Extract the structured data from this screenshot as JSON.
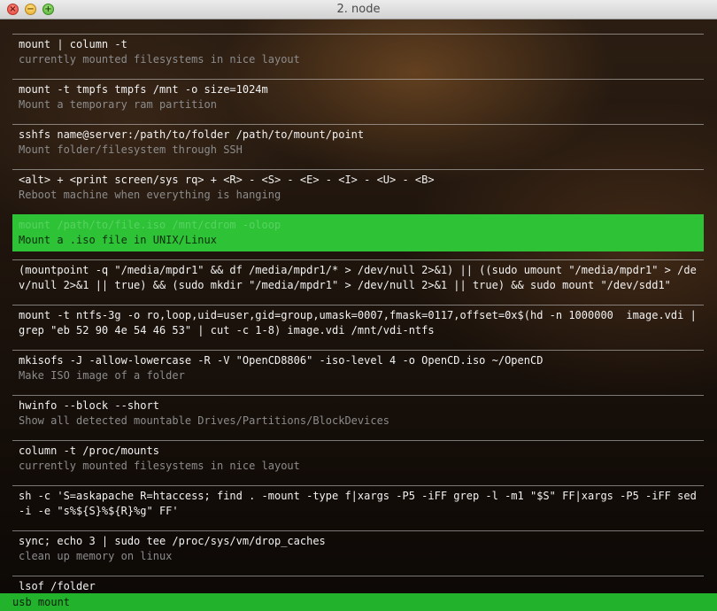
{
  "window": {
    "title": "2. node",
    "controls": {
      "close": "close-icon",
      "minimize": "minimize-icon",
      "zoom": "zoom-icon"
    }
  },
  "colors": {
    "selection": "#2ec236",
    "statusbar": "#22b22b",
    "command_text": "#f2f2f2",
    "description_text": "#8c8c8c"
  },
  "results": [
    {
      "command": "mount | column -t",
      "description": "currently mounted filesystems in nice layout"
    },
    {
      "command": "mount -t tmpfs tmpfs /mnt -o size=1024m",
      "description": "Mount a temporary ram partition"
    },
    {
      "command": "sshfs name@server:/path/to/folder /path/to/mount/point",
      "description": "Mount folder/filesystem through SSH"
    },
    {
      "command": "<alt> + <print screen/sys rq> + <R> - <S> - <E> - <I> - <U> - <B>",
      "description": "Reboot machine when everything is hanging"
    },
    {
      "command": "mount /path/to/file.iso /mnt/cdrom -oloop",
      "description": "Mount a .iso file in UNIX/Linux",
      "selected": true
    },
    {
      "command": "(mountpoint -q \"/media/mpdr1\" && df /media/mpdr1/* > /dev/null 2>&1) || ((sudo umount \"/media/mpdr1\" > /dev/null 2>&1 || true) && (sudo mkdir \"/media/mpdr1\" > /dev/null 2>&1 || true) && sudo mount \"/dev/sdd1\"",
      "description": ""
    },
    {
      "command": "mount -t ntfs-3g -o ro,loop,uid=user,gid=group,umask=0007,fmask=0117,offset=0x$(hd -n 1000000  image.vdi | grep \"eb 52 90 4e 54 46 53\" | cut -c 1-8) image.vdi /mnt/vdi-ntfs",
      "description": ""
    },
    {
      "command": "mkisofs -J -allow-lowercase -R -V \"OpenCD8806\" -iso-level 4 -o OpenCD.iso ~/OpenCD",
      "description": "Make ISO image of a folder"
    },
    {
      "command": "hwinfo --block --short",
      "description": "Show all detected mountable Drives/Partitions/BlockDevices"
    },
    {
      "command": "column -t /proc/mounts",
      "description": "currently mounted filesystems in nice layout"
    },
    {
      "command": "sh -c 'S=askapache R=htaccess; find . -mount -type f|xargs -P5 -iFF grep -l -m1 \"$S\" FF|xargs -P5 -iFF sed -i -e \"s%${S}%${R}%g\" FF'",
      "description": ""
    },
    {
      "command": "sync; echo 3 | sudo tee /proc/sys/vm/drop_caches",
      "description": "clean up memory on linux"
    },
    {
      "command": "lsof /folder",
      "description": ""
    }
  ],
  "search": {
    "query": "usb mount"
  }
}
